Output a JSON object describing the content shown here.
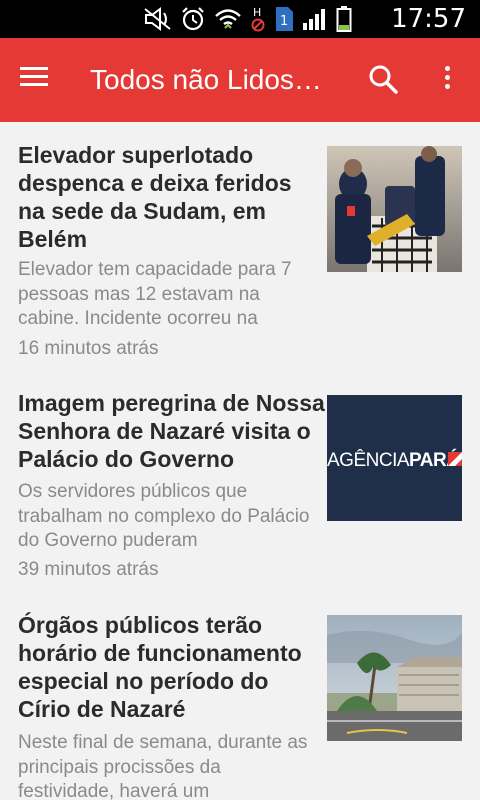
{
  "status_bar": {
    "time": "17:57",
    "icons": [
      "mute-icon",
      "alarm-icon",
      "wifi-icon",
      "no-signal-h-icon",
      "sim-1-icon",
      "signal-icon",
      "battery-icon"
    ],
    "badge": "1"
  },
  "app_bar": {
    "title": "Todos não Lidos…",
    "background": "#e53935",
    "icons": [
      "menu-icon",
      "search-icon",
      "overflow-menu-icon"
    ]
  },
  "articles": [
    {
      "title": "Elevador superlotado despenca e deixa feridos na sede da Sudam, em Belém",
      "summary": "Elevador tem capacidade para 7 pessoas mas 12 estavam na cabine. Incidente ocorreu na",
      "time": "16 minutos atrás",
      "thumbnail": "rescue-workers-photo"
    },
    {
      "title": "Imagem peregrina de Nossa Senhora de Nazaré visita o Palácio do Governo",
      "summary": "Os servidores públicos que trabalham no complexo do Palácio do Governo puderam",
      "time": "39 minutos atrás",
      "thumbnail": "agencia-para-logo",
      "thumbnail_text": "AGÊNCIA PARÁ"
    },
    {
      "title": "Órgãos públicos terão horário de funcionamento especial no período do Círio de Nazaré",
      "summary": "Neste final de semana, durante as principais procissões da festividade, haverá um",
      "thumbnail": "waterfront-street-photo"
    }
  ]
}
